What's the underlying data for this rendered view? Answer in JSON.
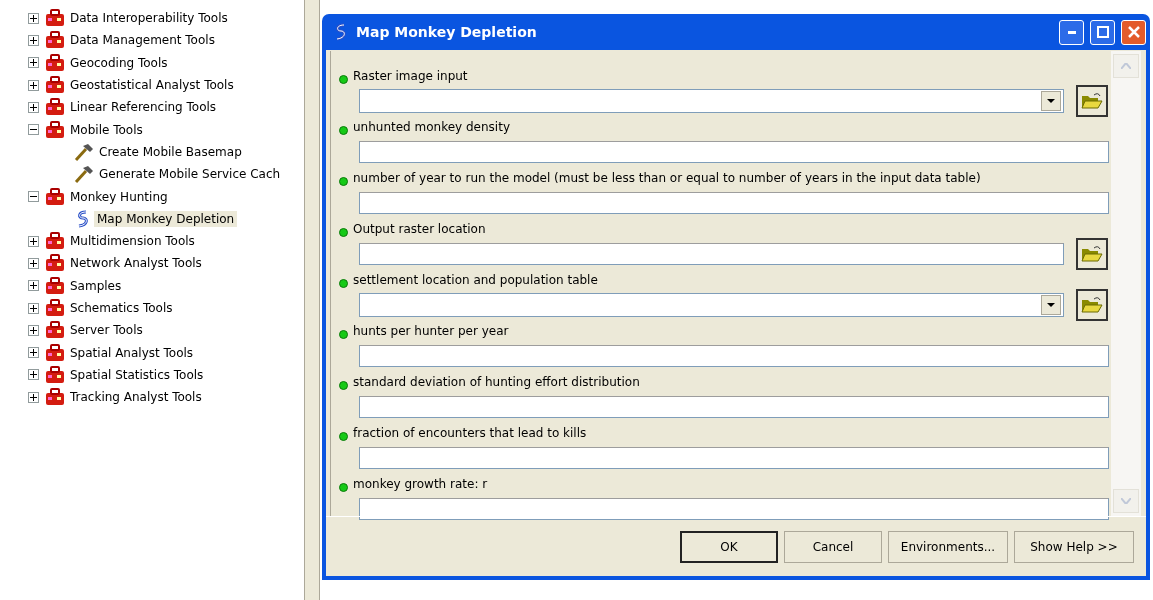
{
  "tree": [
    {
      "label": "Data Interoperability Tools",
      "kind": "toolbox",
      "expanded": false
    },
    {
      "label": "Data Management Tools",
      "kind": "toolbox",
      "expanded": false
    },
    {
      "label": "Geocoding Tools",
      "kind": "toolbox",
      "expanded": false
    },
    {
      "label": "Geostatistical Analyst Tools",
      "kind": "toolbox",
      "expanded": false
    },
    {
      "label": "Linear Referencing Tools",
      "kind": "toolbox",
      "expanded": false
    },
    {
      "label": "Mobile Tools",
      "kind": "toolbox",
      "expanded": true,
      "children": [
        {
          "label": "Create Mobile Basemap",
          "kind": "tool",
          "selected": false
        },
        {
          "label": "Generate Mobile Service Cach",
          "kind": "tool",
          "selected": false
        }
      ]
    },
    {
      "label": "Monkey Hunting",
      "kind": "toolbox",
      "expanded": true,
      "children": [
        {
          "label": "Map Monkey Depletion",
          "kind": "script",
          "selected": true
        }
      ]
    },
    {
      "label": "Multidimension Tools",
      "kind": "toolbox",
      "expanded": false
    },
    {
      "label": "Network Analyst Tools",
      "kind": "toolbox",
      "expanded": false
    },
    {
      "label": "Samples",
      "kind": "toolbox",
      "expanded": false
    },
    {
      "label": "Schematics Tools",
      "kind": "toolbox",
      "expanded": false
    },
    {
      "label": "Server Tools",
      "kind": "toolbox",
      "expanded": false
    },
    {
      "label": "Spatial Analyst Tools",
      "kind": "toolbox",
      "expanded": false
    },
    {
      "label": "Spatial Statistics Tools",
      "kind": "toolbox",
      "expanded": false
    },
    {
      "label": "Tracking Analyst Tools",
      "kind": "toolbox",
      "expanded": false
    }
  ],
  "dialog": {
    "title": "Map Monkey Depletion",
    "params": [
      {
        "label": "Raster image input",
        "kind": "dropdown_browse"
      },
      {
        "label": "unhunted monkey density",
        "kind": "text"
      },
      {
        "label": "number of year to run the model (must be less than or equal to number of years in the input data table)",
        "kind": "text"
      },
      {
        "label": "Output raster location",
        "kind": "text_browse"
      },
      {
        "label": "settlement location and population table",
        "kind": "dropdown_browse"
      },
      {
        "label": "hunts per hunter per year",
        "kind": "text"
      },
      {
        "label": "standard deviation of hunting effort distribution",
        "kind": "text"
      },
      {
        "label": "fraction of encounters that lead to kills",
        "kind": "text"
      },
      {
        "label": "monkey growth rate: r",
        "kind": "text"
      }
    ],
    "buttons": [
      {
        "label": "OK",
        "default": true
      },
      {
        "label": "Cancel",
        "default": false
      },
      {
        "label": "Environments...",
        "default": false
      },
      {
        "label": "Show Help >>",
        "default": false
      }
    ]
  }
}
